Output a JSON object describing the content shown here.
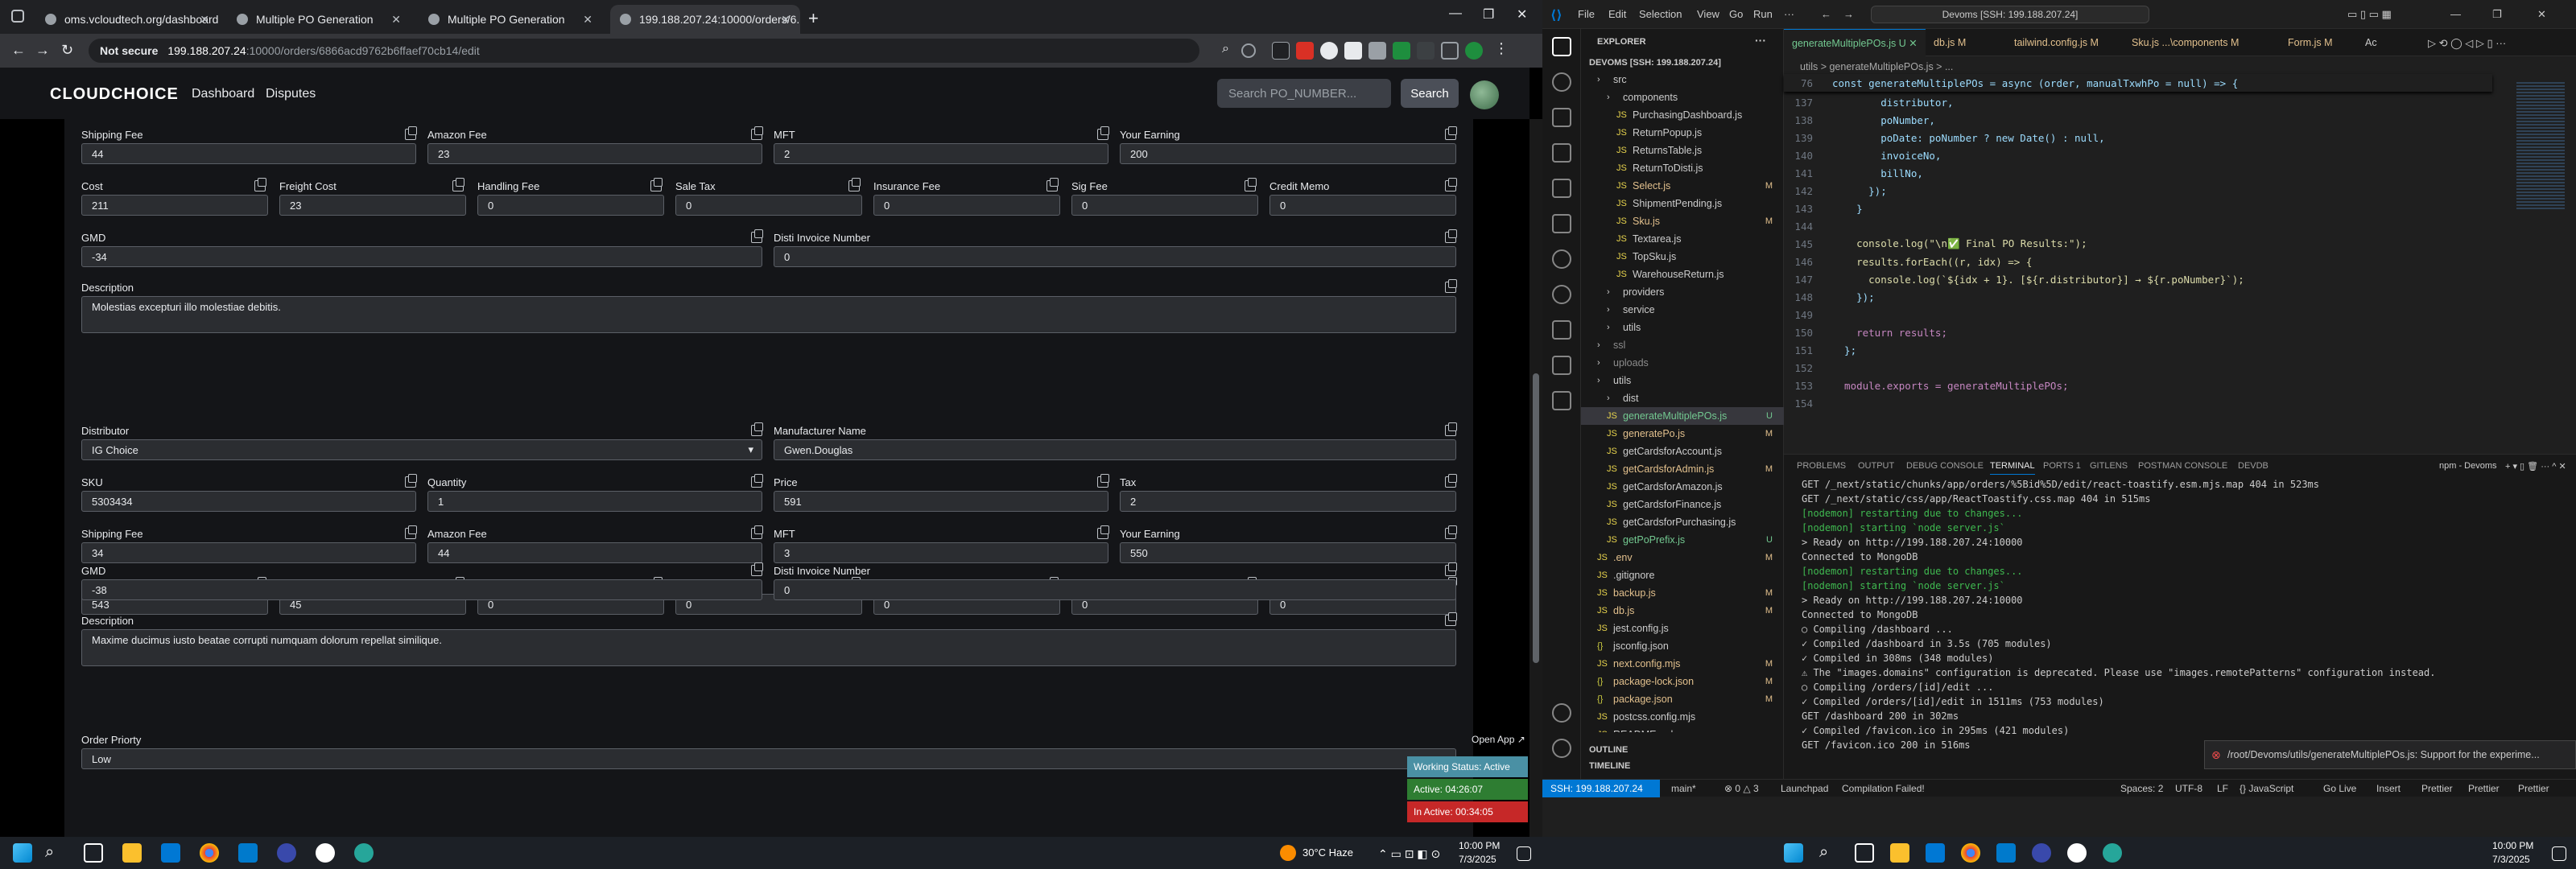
{
  "chrome": {
    "tabs": [
      {
        "title": "oms.vcloudtech.org/dashboard"
      },
      {
        "title": "Multiple PO Generation"
      },
      {
        "title": "Multiple PO Generation"
      },
      {
        "title": "199.188.207.24:10000/orders/6..."
      }
    ],
    "security": "Not secure",
    "url_host": "199.188.207.24",
    "url_path": ":10000/orders/6866acd9762b6ffaef70cb14/edit"
  },
  "app": {
    "logo": "CLOUDCHOICE",
    "nav": [
      "Dashboard",
      "Disputes"
    ],
    "search_placeholder": "Search PO_NUMBER...",
    "search_button": "Search"
  },
  "labels": {
    "shipping_fee": "Shipping Fee",
    "amazon_fee": "Amazon Fee",
    "mft": "MFT",
    "your_earning": "Your Earning",
    "cost": "Cost",
    "freight_cost": "Freight Cost",
    "handling_fee": "Handling Fee",
    "sale_tax": "Sale Tax",
    "insurance_fee": "Insurance Fee",
    "sig_fee": "Sig Fee",
    "credit_memo": "Credit Memo",
    "gmd": "GMD",
    "disti_invoice": "Disti Invoice Number",
    "description": "Description",
    "distributor": "Distributor",
    "manufacturer": "Manufacturer Name",
    "sku": "SKU",
    "quantity": "Quantity",
    "price": "Price",
    "tax": "Tax",
    "order_priority": "Order Priorty"
  },
  "item1": {
    "shipping_fee": "44",
    "amazon_fee": "23",
    "mft": "2",
    "your_earning": "200",
    "cost": "211",
    "freight_cost": "23",
    "handling_fee": "0",
    "sale_tax": "0",
    "insurance_fee": "0",
    "sig_fee": "0",
    "credit_memo": "0",
    "gmd": "-34",
    "disti_invoice": "0",
    "description": "Molestias excepturi illo molestiae debitis."
  },
  "item2": {
    "distributor": "IG Choice",
    "manufacturer": "Gwen.Douglas",
    "sku": "5303434",
    "quantity": "1",
    "price": "591",
    "tax": "2",
    "shipping_fee": "34",
    "amazon_fee": "44",
    "mft": "3",
    "your_earning": "550",
    "cost": "543",
    "freight_cost": "45",
    "handling_fee": "0",
    "sale_tax": "0",
    "insurance_fee": "0",
    "sig_fee": "0",
    "credit_memo": "0",
    "gmd": "-38",
    "disti_invoice": "0",
    "description": "Maxime ducimus iusto beatae corrupti numquam dolorum repellat similique."
  },
  "order_priority": "Low",
  "status_widget": {
    "open_app": "Open App ↗",
    "working": "Working Status: Active",
    "active": "Active: 04:26:07",
    "inactive": "In Active: 00:34:05"
  },
  "taskbar": {
    "weather": "30°C  Haze",
    "time": "10:00 PM",
    "date": "7/3/2025"
  },
  "vscode": {
    "menu": [
      "File",
      "Edit",
      "Selection",
      "View",
      "Go",
      "Run"
    ],
    "command_center": "Devoms [SSH: 199.188.207.24]",
    "explorer_title": "EXPLORER",
    "workspace": "DEVOMS [SSH: 199.188.207.24]",
    "tree": [
      {
        "name": "src",
        "mark": ""
      },
      {
        "name": "components",
        "mark": ""
      },
      {
        "name": "PurchasingDashboard.js",
        "mark": ""
      },
      {
        "name": "ReturnPopup.js",
        "mark": ""
      },
      {
        "name": "ReturnsTable.js",
        "mark": ""
      },
      {
        "name": "ReturnToDisti.js",
        "mark": ""
      },
      {
        "name": "Select.js",
        "mark": "M"
      },
      {
        "name": "ShipmentPending.js",
        "mark": ""
      },
      {
        "name": "Sku.js",
        "mark": "M"
      },
      {
        "name": "Textarea.js",
        "mark": ""
      },
      {
        "name": "TopSku.js",
        "mark": ""
      },
      {
        "name": "WarehouseReturn.js",
        "mark": ""
      },
      {
        "name": "providers",
        "mark": ""
      },
      {
        "name": "service",
        "mark": ""
      },
      {
        "name": "utils",
        "mark": ""
      },
      {
        "name": "ssl",
        "mark": ""
      },
      {
        "name": "uploads",
        "mark": ""
      },
      {
        "name": "utils",
        "mark": ""
      },
      {
        "name": "dist",
        "mark": ""
      },
      {
        "name": "generateMultiplePOs.js",
        "mark": "U"
      },
      {
        "name": "generatePo.js",
        "mark": "M"
      },
      {
        "name": "getCardsforAccount.js",
        "mark": ""
      },
      {
        "name": "getCardsforAdmin.js",
        "mark": "M"
      },
      {
        "name": "getCardsforAmazon.js",
        "mark": ""
      },
      {
        "name": "getCardsforFinance.js",
        "mark": ""
      },
      {
        "name": "getCardsforPurchasing.js",
        "mark": ""
      },
      {
        "name": "getPoPrefix.js",
        "mark": "U"
      },
      {
        "name": ".env",
        "mark": "M"
      },
      {
        "name": ".gitignore",
        "mark": ""
      },
      {
        "name": "backup.js",
        "mark": "M"
      },
      {
        "name": "db.js",
        "mark": "M"
      },
      {
        "name": "jest.config.js",
        "mark": ""
      },
      {
        "name": "jsconfig.json",
        "mark": ""
      },
      {
        "name": "next.config.mjs",
        "mark": "M"
      },
      {
        "name": "package-lock.json",
        "mark": "M"
      },
      {
        "name": "package.json",
        "mark": "M"
      },
      {
        "name": "postcss.config.mjs",
        "mark": ""
      },
      {
        "name": "README.md",
        "mark": ""
      }
    ],
    "outline": "OUTLINE",
    "timeline": "TIMELINE",
    "tabs": [
      {
        "name": "generateMultiplePOs.js",
        "mark": "U"
      },
      {
        "name": "db.js",
        "mark": "M"
      },
      {
        "name": "tailwind.config.js",
        "mark": "M"
      },
      {
        "name": "Sku.js",
        "mark": "...\\components M"
      },
      {
        "name": "Form.js",
        "mark": "M"
      },
      {
        "name": "Ac",
        "mark": ""
      }
    ],
    "breadcrumb": "utils > generateMultiplePOs.js > ...",
    "sticky": "const generateMultiplePOs = async (order, manualTxwhPo = null) => {",
    "sticky_ln": "76",
    "code": [
      {
        "ln": "137",
        "text": "        distributor,"
      },
      {
        "ln": "138",
        "text": "        poNumber,"
      },
      {
        "ln": "139",
        "text": "        poDate: poNumber ? new Date() : null,"
      },
      {
        "ln": "140",
        "text": "        invoiceNo,"
      },
      {
        "ln": "141",
        "text": "        billNo,"
      },
      {
        "ln": "142",
        "text": "      });"
      },
      {
        "ln": "143",
        "text": "    }"
      },
      {
        "ln": "144",
        "text": ""
      },
      {
        "ln": "145",
        "text": "    console.log(\"\\n✅ Final PO Results:\");"
      },
      {
        "ln": "146",
        "text": "    results.forEach((r, idx) => {"
      },
      {
        "ln": "147",
        "text": "      console.log(`${idx + 1}. [${r.distributor}] → ${r.poNumber}`);"
      },
      {
        "ln": "148",
        "text": "    });"
      },
      {
        "ln": "149",
        "text": ""
      },
      {
        "ln": "150",
        "text": "    return results;"
      },
      {
        "ln": "151",
        "text": "  };"
      },
      {
        "ln": "152",
        "text": ""
      },
      {
        "ln": "153",
        "text": "  module.exports = generateMultiplePOs;"
      },
      {
        "ln": "154",
        "text": ""
      }
    ],
    "panel_tabs": [
      "PROBLEMS",
      "OUTPUT",
      "DEBUG CONSOLE",
      "TERMINAL",
      "PORTS 1",
      "GITLENS",
      "POSTMAN CONSOLE",
      "DEVDB"
    ],
    "terminal_title": "npm - Devoms",
    "terminal": [
      "GET /_next/static/chunks/app/orders/%5Bid%5D/edit/react-toastify.esm.mjs.map 404 in 523ms",
      "GET /_next/static/css/app/ReactToastify.css.map 404 in 515ms",
      "[nodemon] restarting due to changes...",
      "[nodemon] starting `node server.js`",
      "> Ready on http://199.188.207.24:10000",
      "Connected to MongoDB",
      "[nodemon] restarting due to changes...",
      "[nodemon] starting `node server.js`",
      "> Ready on http://199.188.207.24:10000",
      "Connected to MongoDB",
      "○ Compiling /dashboard ...",
      "✓ Compiled /dashboard in 3.5s (705 modules)",
      "✓ Compiled in 308ms (348 modules)",
      "⚠ The \"images.domains\" configuration is deprecated. Please use \"images.remotePatterns\" configuration instead.",
      "○ Compiling /orders/[id]/edit ...",
      "✓ Compiled /orders/[id]/edit in 1511ms (753 modules)",
      "GET /dashboard 200 in 302ms",
      "✓ Compiled /favicon.ico in 295ms (421 modules)",
      "GET /favicon.ico 200 in 516ms"
    ],
    "toast": "/root/Devoms/utils/generateMultiplePOs.js: Support for the experime...",
    "status": {
      "ssh": "SSH: 199.188.207.24",
      "branch": "main*",
      "errors": "⊗ 0  △ 3",
      "launchpad": "Launchpad",
      "compile": "Compilation Failed!",
      "spaces": "Spaces: 2",
      "enc": "UTF-8",
      "eol": "LF",
      "lang": "{} JavaScript",
      "golive": "Go Live",
      "insert": "Insert",
      "prettier1": "Prettier",
      "prettier2": "Prettier",
      "prettier3": "Prettier"
    },
    "tb_time": "10:00 PM",
    "tb_date": "7/3/2025"
  },
  "colors": {
    "accent": "#0078d4",
    "working": "#4a90a4",
    "active": "#2e7d32",
    "inactive": "#c62828"
  }
}
